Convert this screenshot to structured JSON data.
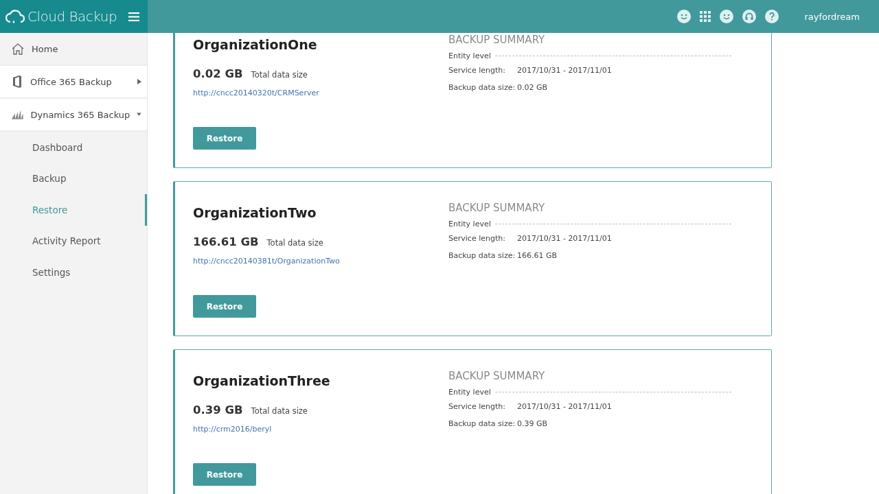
{
  "brand": {
    "name": "Cloud Backup"
  },
  "user": "rayfordream",
  "sidebar": {
    "items": [
      {
        "kind": "top",
        "label": "Home",
        "selected": false
      },
      {
        "kind": "group",
        "label": "Office 365 Backup",
        "expanded": false,
        "selected": false
      },
      {
        "kind": "group",
        "label": "Dynamics 365 Backup",
        "expanded": true,
        "selected": false
      },
      {
        "kind": "sub",
        "label": "Dashboard",
        "selected": false
      },
      {
        "kind": "sub",
        "label": "Backup",
        "selected": false
      },
      {
        "kind": "sub",
        "label": "Restore",
        "selected": true
      },
      {
        "kind": "sub",
        "label": "Activity Report",
        "selected": false
      },
      {
        "kind": "sub",
        "label": "Settings",
        "selected": false
      }
    ]
  },
  "organizations": [
    {
      "name": "OrganizationOne",
      "size": "0.02 GB",
      "size_label": "Total data size",
      "url": "http://cncc20140320t/CRMServer",
      "button": "Restore",
      "summary": {
        "title": "BACKUP SUMMARY",
        "entity_label": "Entity level",
        "service_label": "Service length:",
        "service_value": "2017/10/31 - 2017/11/01",
        "data_label": "Backup data size:",
        "data_value": "0.02 GB"
      }
    },
    {
      "name": "OrganizationTwo",
      "size": "166.61 GB",
      "size_label": "Total data size",
      "url": "http://cncc20140381t/OrganizationTwo",
      "button": "Restore",
      "summary": {
        "title": "BACKUP SUMMARY",
        "entity_label": "Entity level",
        "service_label": "Service length:",
        "service_value": "2017/10/31 - 2017/11/01",
        "data_label": "Backup data size:",
        "data_value": "166.61 GB"
      }
    },
    {
      "name": "OrganizationThree",
      "size": "0.39 GB",
      "size_label": "Total data size",
      "url": "http://crm2016/beryl",
      "button": "Restore",
      "summary": {
        "title": "BACKUP SUMMARY",
        "entity_label": "Entity level",
        "service_label": "Service length:",
        "service_value": "2017/10/31 - 2017/11/01",
        "data_label": "Backup data size:",
        "data_value": "0.39 GB"
      }
    }
  ]
}
